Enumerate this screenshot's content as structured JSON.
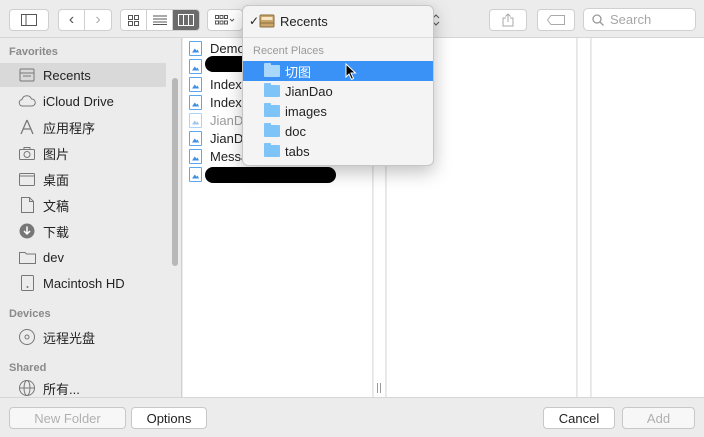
{
  "toolbar": {
    "search_placeholder": "Search"
  },
  "popup": {
    "current": "Recents",
    "check_mark": "✓",
    "section_header": "Recent Places",
    "places": [
      "切图",
      "JianDao",
      "images",
      "doc",
      "tabs"
    ],
    "highlighted_index": 0
  },
  "sidebar": {
    "favorites_title": "Favorites",
    "favorites": [
      {
        "label": "Recents",
        "icon": "recents-icon",
        "selected": true
      },
      {
        "label": "iCloud Drive",
        "icon": "cloud-icon"
      },
      {
        "label": "应用程序",
        "icon": "applications-icon"
      },
      {
        "label": "图片",
        "icon": "camera-icon"
      },
      {
        "label": "桌面",
        "icon": "desktop-icon"
      },
      {
        "label": "文稿",
        "icon": "document-icon"
      },
      {
        "label": "下载",
        "icon": "download-icon"
      },
      {
        "label": "dev",
        "icon": "folder-icon"
      },
      {
        "label": "Macintosh HD",
        "icon": "disk-icon"
      }
    ],
    "devices_title": "Devices",
    "devices": [
      {
        "label": "远程光盘",
        "icon": "disc-icon"
      }
    ],
    "shared_title": "Shared",
    "shared": [
      {
        "label": "所有...",
        "icon": "network-icon"
      }
    ]
  },
  "files": [
    {
      "label": "Demo"
    },
    {
      "label": ""
    },
    {
      "label": "Indexe"
    },
    {
      "label": "Indexe"
    },
    {
      "label": "JianD",
      "dim": true
    },
    {
      "label": "JianD"
    },
    {
      "label": "Messa"
    },
    {
      "label": ""
    }
  ],
  "bottombar": {
    "new_folder": "New Folder",
    "options": "Options",
    "cancel": "Cancel",
    "add": "Add"
  }
}
